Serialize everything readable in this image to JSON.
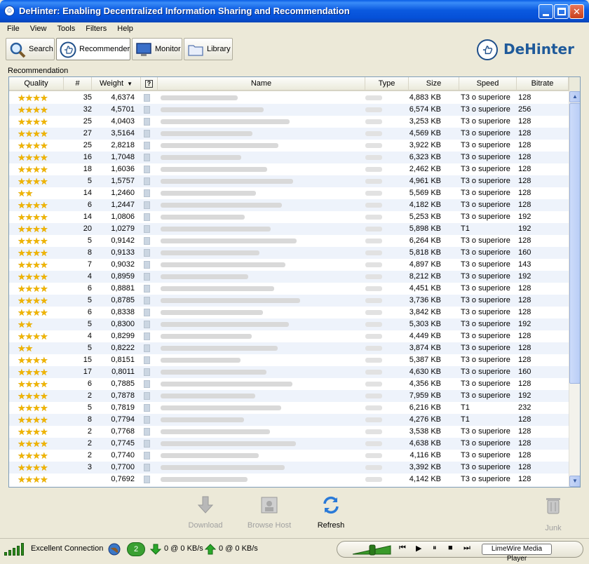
{
  "window": {
    "title": "DeHinter: Enabling Decentralized Information Sharing and Recommendation"
  },
  "menu": [
    "File",
    "View",
    "Tools",
    "Filters",
    "Help"
  ],
  "tabs": [
    {
      "label": "Search"
    },
    {
      "label": "Recommender"
    },
    {
      "label": "Monitor"
    },
    {
      "label": "Library"
    }
  ],
  "brand": "DeHinter",
  "panel": {
    "label": "Recommendation",
    "columns": [
      "Quality",
      "#",
      "Weight",
      "?",
      "Name",
      "Type",
      "Size",
      "Speed",
      "Bitrate"
    ],
    "sort_indicator": "▼"
  },
  "rows": [
    {
      "stars": 4,
      "num": "35",
      "weight": "4,6374",
      "size": "4,883 KB",
      "speed": "T3 o superiore",
      "bitrate": "128"
    },
    {
      "stars": 4,
      "num": "32",
      "weight": "4,5701",
      "size": "6,574 KB",
      "speed": "T3 o superiore",
      "bitrate": "256"
    },
    {
      "stars": 4,
      "num": "25",
      "weight": "4,0403",
      "size": "3,253 KB",
      "speed": "T3 o superiore",
      "bitrate": "128"
    },
    {
      "stars": 4,
      "num": "27",
      "weight": "3,5164",
      "size": "4,569 KB",
      "speed": "T3 o superiore",
      "bitrate": "128"
    },
    {
      "stars": 4,
      "num": "25",
      "weight": "2,8218",
      "size": "3,922 KB",
      "speed": "T3 o superiore",
      "bitrate": "128"
    },
    {
      "stars": 4,
      "num": "16",
      "weight": "1,7048",
      "size": "6,323 KB",
      "speed": "T3 o superiore",
      "bitrate": "128"
    },
    {
      "stars": 4,
      "num": "18",
      "weight": "1,6036",
      "size": "2,462 KB",
      "speed": "T3 o superiore",
      "bitrate": "128"
    },
    {
      "stars": 4,
      "num": "5",
      "weight": "1,5757",
      "size": "4,961 KB",
      "speed": "T3 o superiore",
      "bitrate": "128"
    },
    {
      "stars": 2,
      "num": "14",
      "weight": "1,2460",
      "size": "5,569 KB",
      "speed": "T3 o superiore",
      "bitrate": "128"
    },
    {
      "stars": 4,
      "num": "6",
      "weight": "1,2447",
      "size": "4,182 KB",
      "speed": "T3 o superiore",
      "bitrate": "128"
    },
    {
      "stars": 4,
      "num": "14",
      "weight": "1,0806",
      "size": "5,253 KB",
      "speed": "T3 o superiore",
      "bitrate": "192"
    },
    {
      "stars": 4,
      "num": "20",
      "weight": "1,0279",
      "size": "5,898 KB",
      "speed": "T1",
      "bitrate": "192"
    },
    {
      "stars": 4,
      "num": "5",
      "weight": "0,9142",
      "size": "6,264 KB",
      "speed": "T3 o superiore",
      "bitrate": "128"
    },
    {
      "stars": 4,
      "num": "8",
      "weight": "0,9133",
      "size": "5,818 KB",
      "speed": "T3 o superiore",
      "bitrate": "160"
    },
    {
      "stars": 4,
      "num": "7",
      "weight": "0,9032",
      "size": "4,897 KB",
      "speed": "T3 o superiore",
      "bitrate": "143"
    },
    {
      "stars": 4,
      "num": "4",
      "weight": "0,8959",
      "size": "8,212 KB",
      "speed": "T3 o superiore",
      "bitrate": "192"
    },
    {
      "stars": 4,
      "num": "6",
      "weight": "0,8881",
      "size": "4,451 KB",
      "speed": "T3 o superiore",
      "bitrate": "128"
    },
    {
      "stars": 4,
      "num": "5",
      "weight": "0,8785",
      "size": "3,736 KB",
      "speed": "T3 o superiore",
      "bitrate": "128"
    },
    {
      "stars": 4,
      "num": "6",
      "weight": "0,8338",
      "size": "3,842 KB",
      "speed": "T3 o superiore",
      "bitrate": "128"
    },
    {
      "stars": 2,
      "num": "5",
      "weight": "0,8300",
      "size": "5,303 KB",
      "speed": "T3 o superiore",
      "bitrate": "192"
    },
    {
      "stars": 4,
      "num": "4",
      "weight": "0,8299",
      "size": "4,449 KB",
      "speed": "T3 o superiore",
      "bitrate": "128"
    },
    {
      "stars": 2,
      "num": "5",
      "weight": "0,8222",
      "size": "3,874 KB",
      "speed": "T3 o superiore",
      "bitrate": "128"
    },
    {
      "stars": 4,
      "num": "15",
      "weight": "0,8151",
      "size": "5,387 KB",
      "speed": "T3 o superiore",
      "bitrate": "128"
    },
    {
      "stars": 4,
      "num": "17",
      "weight": "0,8011",
      "size": "4,630 KB",
      "speed": "T3 o superiore",
      "bitrate": "160"
    },
    {
      "stars": 4,
      "num": "6",
      "weight": "0,7885",
      "size": "4,356 KB",
      "speed": "T3 o superiore",
      "bitrate": "128"
    },
    {
      "stars": 4,
      "num": "2",
      "weight": "0,7878",
      "size": "7,959 KB",
      "speed": "T3 o superiore",
      "bitrate": "192"
    },
    {
      "stars": 4,
      "num": "5",
      "weight": "0,7819",
      "size": "6,216 KB",
      "speed": "T1",
      "bitrate": "232"
    },
    {
      "stars": 4,
      "num": "8",
      "weight": "0,7794",
      "size": "4,276 KB",
      "speed": "T1",
      "bitrate": "128"
    },
    {
      "stars": 4,
      "num": "2",
      "weight": "0,7768",
      "size": "3,538 KB",
      "speed": "T3 o superiore",
      "bitrate": "128"
    },
    {
      "stars": 4,
      "num": "2",
      "weight": "0,7745",
      "size": "4,638 KB",
      "speed": "T3 o superiore",
      "bitrate": "128"
    },
    {
      "stars": 4,
      "num": "2",
      "weight": "0,7740",
      "size": "4,116 KB",
      "speed": "T3 o superiore",
      "bitrate": "128"
    },
    {
      "stars": 4,
      "num": "3",
      "weight": "0,7700",
      "size": "3,392 KB",
      "speed": "T3 o superiore",
      "bitrate": "128"
    },
    {
      "stars": 4,
      "num": "",
      "weight": "0,7692",
      "size": "4,142 KB",
      "speed": "T3 o superiore",
      "bitrate": "128"
    }
  ],
  "actions": {
    "download": "Download",
    "browse_host": "Browse Host",
    "refresh": "Refresh",
    "junk": "Junk"
  },
  "status": {
    "connection": "Excellent Connection",
    "count": "2",
    "down": "0 @ 0 KB/s",
    "up": "0 @ 0 KB/s",
    "player": "LimeWire Media Player"
  },
  "colors": {
    "star": "#f0b400",
    "accent": "#0b5ae0",
    "brand": "#1f5a9a"
  }
}
